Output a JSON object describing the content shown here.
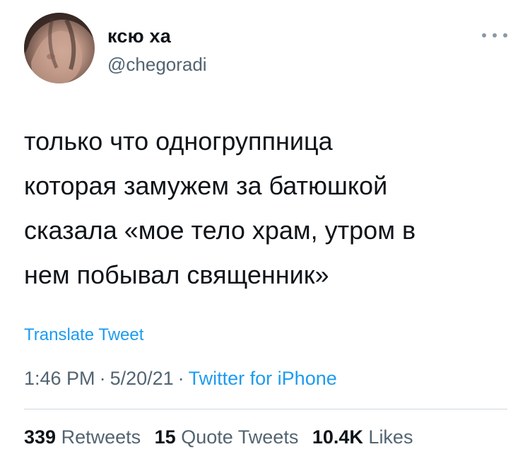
{
  "author": {
    "display_name": "ксю ха",
    "handle": "@chegoradi",
    "avatar_icon": "profile-photo"
  },
  "menu": {
    "icon": "more-horizontal-icon"
  },
  "tweet": {
    "text": "только что одногруппница\nкоторая замужем за батюшкой\nсказала «мое тело храм, утром в\nнем побывал священник»",
    "translate_label": "Translate Tweet"
  },
  "meta": {
    "time": "1:46 PM",
    "date": "5/20/21",
    "source": "Twitter for iPhone",
    "separator": "·"
  },
  "stats": {
    "retweets_count": "339",
    "retweets_label": "Retweets",
    "quotes_count": "15",
    "quotes_label": "Quote Tweets",
    "likes_count": "10.4K",
    "likes_label": "Likes"
  },
  "colors": {
    "accent": "#1d9bf0",
    "secondary_text": "#536471",
    "primary_text": "#0f1419"
  }
}
